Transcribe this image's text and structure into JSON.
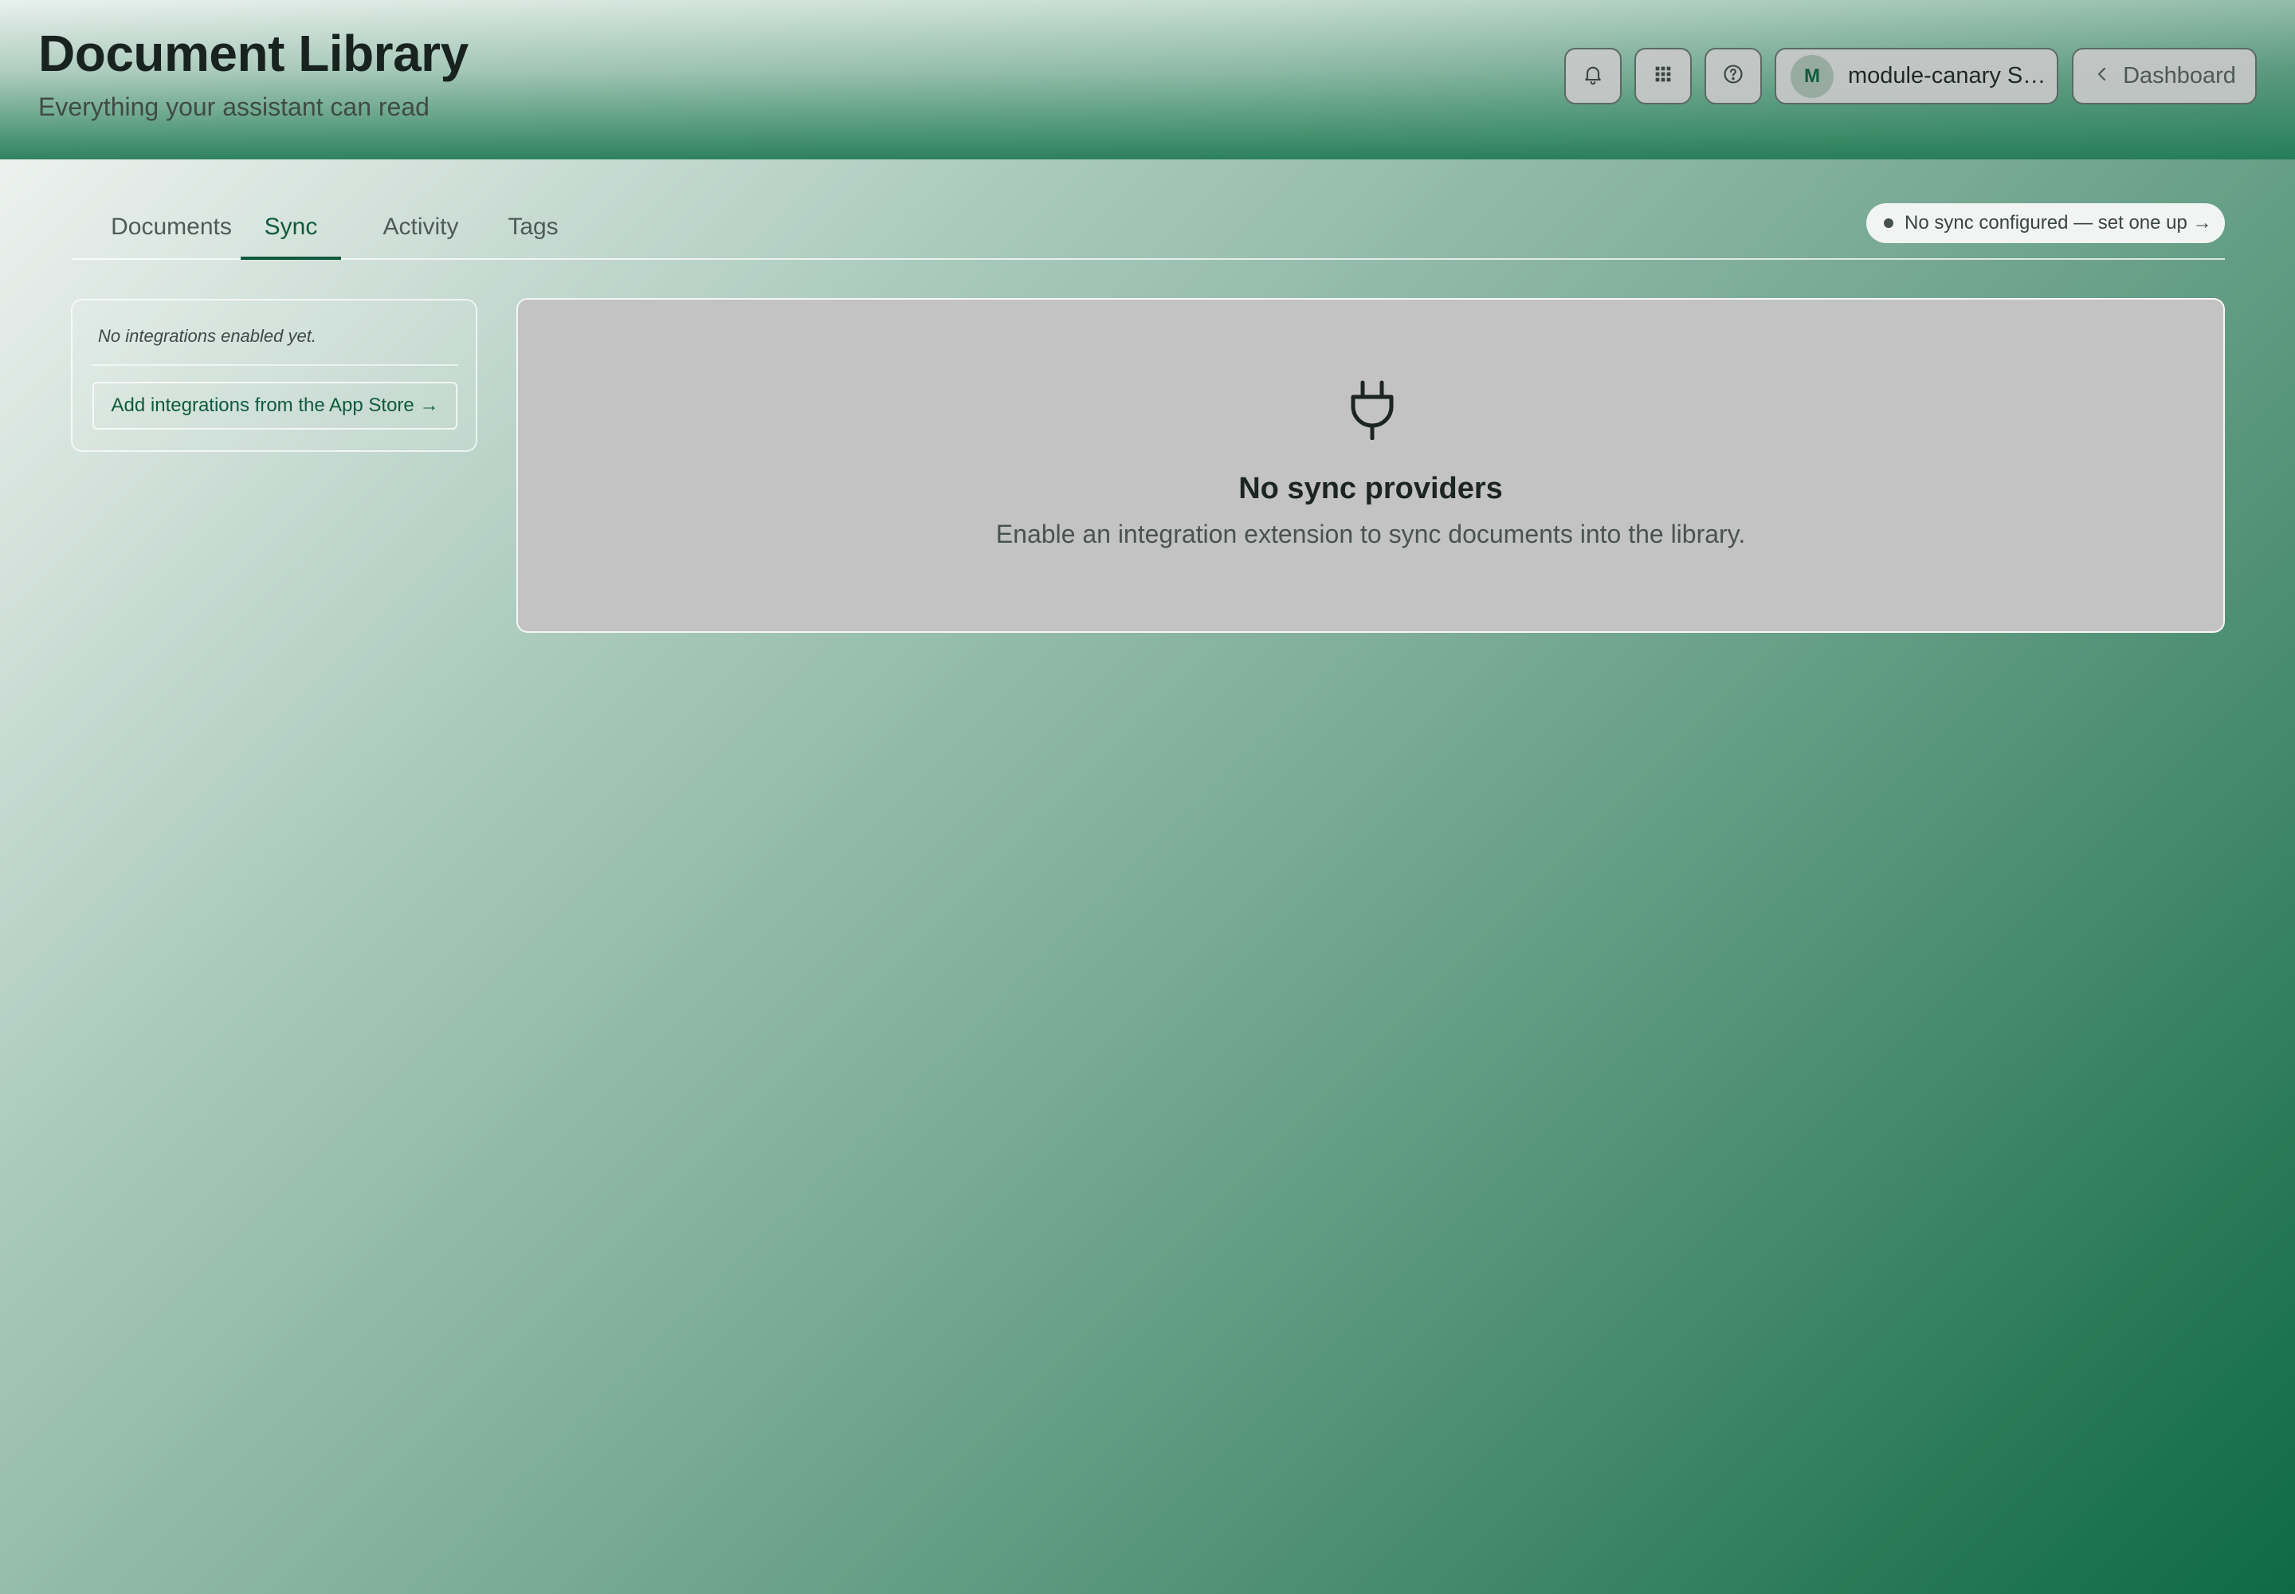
{
  "header": {
    "title": "Document Library",
    "subtitle": "Everything your assistant can read",
    "icons": [
      "bell-icon",
      "grid-icon",
      "help-icon"
    ],
    "account": {
      "avatar_initial": "M",
      "name": "module-canary S…"
    },
    "back_button_label": "Dashboard"
  },
  "tabs": [
    {
      "label": "Documents",
      "active": false
    },
    {
      "label": "Sync",
      "active": true
    },
    {
      "label": "Activity",
      "active": false
    },
    {
      "label": "Tags",
      "active": false
    }
  ],
  "sync_status": {
    "text": "No sync configured — set one up →"
  },
  "integrations_panel": {
    "empty_text": "No integrations enabled yet.",
    "link_label": "Add integrations from the App Store →"
  },
  "empty_state": {
    "icon": "plug-icon",
    "title": "No sync providers",
    "description": "Enable an integration extension to sync documents into the library."
  },
  "colors": {
    "accent": "#0f5a3e",
    "card_bg": "#c3c3c3"
  }
}
